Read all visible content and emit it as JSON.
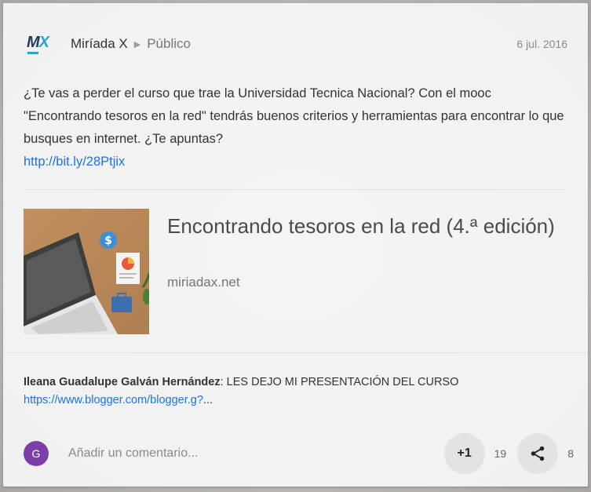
{
  "post": {
    "author": "Miríada X",
    "audience": "Público",
    "date": "6 jul. 2016",
    "text": "¿Te vas a perder el curso que trae la Universidad Tecnica Nacional? Con el mooc \"Encontrando tesoros en la red\" tendrás buenos criterios y herramientas para encontrar lo que busques en internet. ¿Te apuntas?",
    "link": "http://bit.ly/28Ptjix"
  },
  "preview": {
    "title": "Encontrando tesoros en la red (4.ª edición)",
    "domain": "miriadax.net"
  },
  "comment": {
    "author": "Ileana Guadalupe Galván Hernández",
    "text": "LES DEJO MI PRESENTACIÓN DEL CURSO",
    "link": "https://www.blogger.com/blogger.g?",
    "ellipsis": "..."
  },
  "footer": {
    "avatar_initial": "G",
    "comment_placeholder": "Añadir un comentario...",
    "plus_one_label": "+1",
    "plus_one_count": "19",
    "share_count": "8"
  },
  "logo": {
    "m": "M",
    "x": "X"
  },
  "colors": {
    "link": "#1a73e8",
    "avatar": "#7b3fa8",
    "logo_dark": "#1f3a5f",
    "logo_accent": "#2aa6c9"
  }
}
